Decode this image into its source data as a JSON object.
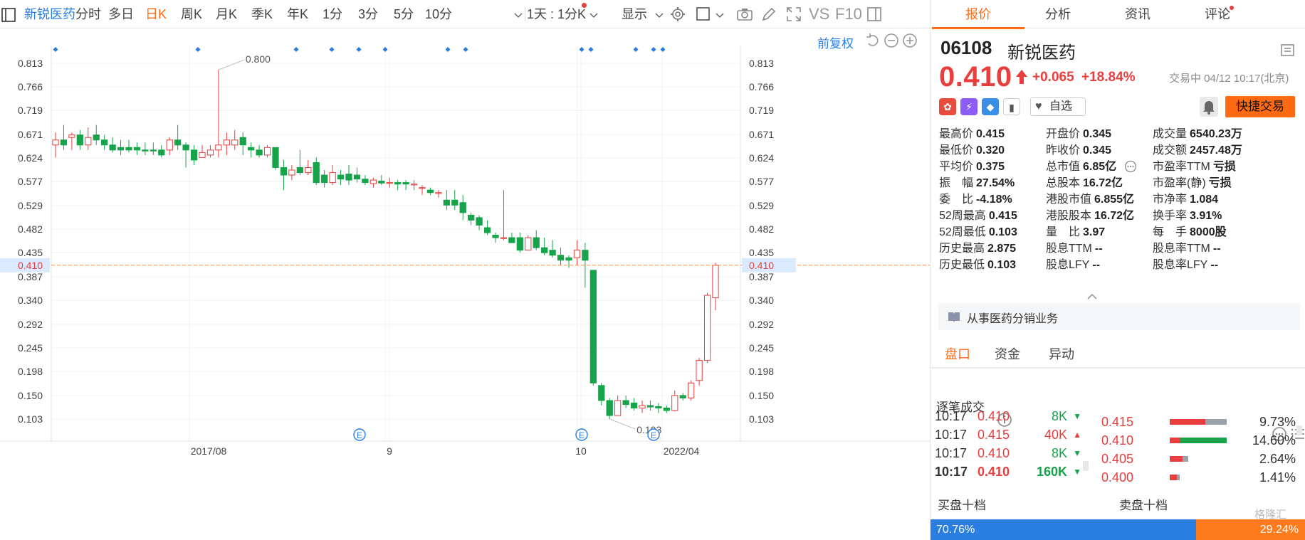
{
  "toolbar": {
    "stock_name": "新锐医药",
    "periods": [
      "分时",
      "多日",
      "日K",
      "周K",
      "月K",
      "季K",
      "年K",
      "1分",
      "3分",
      "5分",
      "10分"
    ],
    "active_period": "日K",
    "interval_select": "1天 : 1分K",
    "display_label": "显示",
    "vs_label": "VS",
    "f10_label": "F10"
  },
  "chart": {
    "fq_label": "前复权",
    "y_ticks": [
      "0.813",
      "0.766",
      "0.719",
      "0.671",
      "0.624",
      "0.577",
      "0.529",
      "0.482",
      "0.435",
      "0.387",
      "0.340",
      "0.292",
      "0.245",
      "0.198",
      "0.150",
      "0.103"
    ],
    "x_labels": [
      "2017/08",
      "9",
      "10",
      "2022/04"
    ],
    "current_price_tag": "0.410",
    "max_annotation": "0.800",
    "min_annotation": "0.103",
    "event_marker": "E"
  },
  "chart_data": {
    "type": "candlestick",
    "ylim": [
      0.103,
      0.813
    ],
    "current_price": 0.41,
    "candles": [
      {
        "o": 0.65,
        "c": 0.66,
        "h": 0.675,
        "l": 0.625
      },
      {
        "o": 0.66,
        "c": 0.65,
        "h": 0.69,
        "l": 0.64
      },
      {
        "o": 0.665,
        "c": 0.67,
        "h": 0.675,
        "l": 0.64
      },
      {
        "o": 0.67,
        "c": 0.65,
        "h": 0.68,
        "l": 0.64
      },
      {
        "o": 0.65,
        "c": 0.665,
        "h": 0.685,
        "l": 0.64
      },
      {
        "o": 0.67,
        "c": 0.66,
        "h": 0.69,
        "l": 0.65
      },
      {
        "o": 0.66,
        "c": 0.65,
        "h": 0.67,
        "l": 0.64
      },
      {
        "o": 0.65,
        "c": 0.64,
        "h": 0.665,
        "l": 0.635
      },
      {
        "o": 0.645,
        "c": 0.64,
        "h": 0.66,
        "l": 0.63
      },
      {
        "o": 0.645,
        "c": 0.64,
        "h": 0.66,
        "l": 0.635
      },
      {
        "o": 0.645,
        "c": 0.64,
        "h": 0.655,
        "l": 0.63
      },
      {
        "o": 0.64,
        "c": 0.638,
        "h": 0.655,
        "l": 0.63
      },
      {
        "o": 0.64,
        "c": 0.638,
        "h": 0.655,
        "l": 0.63
      },
      {
        "o": 0.64,
        "c": 0.63,
        "h": 0.65,
        "l": 0.625
      },
      {
        "o": 0.64,
        "c": 0.66,
        "h": 0.665,
        "l": 0.63
      },
      {
        "o": 0.66,
        "c": 0.65,
        "h": 0.69,
        "l": 0.64
      },
      {
        "o": 0.65,
        "c": 0.64,
        "h": 0.655,
        "l": 0.605
      },
      {
        "o": 0.64,
        "c": 0.62,
        "h": 0.65,
        "l": 0.61
      },
      {
        "o": 0.625,
        "c": 0.635,
        "h": 0.65,
        "l": 0.625
      },
      {
        "o": 0.63,
        "c": 0.64,
        "h": 0.65,
        "l": 0.625
      },
      {
        "o": 0.64,
        "c": 0.65,
        "h": 0.8,
        "l": 0.625
      },
      {
        "o": 0.65,
        "c": 0.66,
        "h": 0.675,
        "l": 0.63
      },
      {
        "o": 0.65,
        "c": 0.66,
        "h": 0.68,
        "l": 0.64
      },
      {
        "o": 0.665,
        "c": 0.65,
        "h": 0.675,
        "l": 0.63
      },
      {
        "o": 0.645,
        "c": 0.64,
        "h": 0.655,
        "l": 0.625
      },
      {
        "o": 0.64,
        "c": 0.63,
        "h": 0.65,
        "l": 0.625
      },
      {
        "o": 0.63,
        "c": 0.645,
        "h": 0.65,
        "l": 0.625
      },
      {
        "o": 0.645,
        "c": 0.605,
        "h": 0.645,
        "l": 0.6
      },
      {
        "o": 0.605,
        "c": 0.59,
        "h": 0.62,
        "l": 0.56
      },
      {
        "o": 0.59,
        "c": 0.6,
        "h": 0.61,
        "l": 0.58
      },
      {
        "o": 0.605,
        "c": 0.595,
        "h": 0.64,
        "l": 0.59
      },
      {
        "o": 0.595,
        "c": 0.605,
        "h": 0.62,
        "l": 0.59
      },
      {
        "o": 0.615,
        "c": 0.575,
        "h": 0.625,
        "l": 0.57
      },
      {
        "o": 0.59,
        "c": 0.575,
        "h": 0.6,
        "l": 0.565
      },
      {
        "o": 0.575,
        "c": 0.595,
        "h": 0.61,
        "l": 0.57
      },
      {
        "o": 0.59,
        "c": 0.582,
        "h": 0.6,
        "l": 0.57
      },
      {
        "o": 0.592,
        "c": 0.58,
        "h": 0.61,
        "l": 0.57
      },
      {
        "o": 0.59,
        "c": 0.582,
        "h": 0.605,
        "l": 0.575
      },
      {
        "o": 0.582,
        "c": 0.575,
        "h": 0.59,
        "l": 0.57
      },
      {
        "o": 0.573,
        "c": 0.58,
        "h": 0.585,
        "l": 0.565
      },
      {
        "o": 0.578,
        "c": 0.574,
        "h": 0.59,
        "l": 0.57
      },
      {
        "o": 0.575,
        "c": 0.575,
        "h": 0.585,
        "l": 0.565
      },
      {
        "o": 0.575,
        "c": 0.572,
        "h": 0.58,
        "l": 0.56
      },
      {
        "o": 0.575,
        "c": 0.572,
        "h": 0.58,
        "l": 0.56
      },
      {
        "o": 0.572,
        "c": 0.572,
        "h": 0.58,
        "l": 0.56
      },
      {
        "o": 0.565,
        "c": 0.565,
        "h": 0.57,
        "l": 0.55
      },
      {
        "o": 0.56,
        "c": 0.555,
        "h": 0.565,
        "l": 0.55
      },
      {
        "o": 0.555,
        "c": 0.555,
        "h": 0.56,
        "l": 0.545
      },
      {
        "o": 0.54,
        "c": 0.53,
        "h": 0.56,
        "l": 0.52
      },
      {
        "o": 0.54,
        "c": 0.53,
        "h": 0.56,
        "l": 0.52
      },
      {
        "o": 0.535,
        "c": 0.515,
        "h": 0.55,
        "l": 0.5
      },
      {
        "o": 0.51,
        "c": 0.5,
        "h": 0.515,
        "l": 0.49
      },
      {
        "o": 0.505,
        "c": 0.49,
        "h": 0.51,
        "l": 0.48
      },
      {
        "o": 0.485,
        "c": 0.475,
        "h": 0.5,
        "l": 0.47
      },
      {
        "o": 0.47,
        "c": 0.465,
        "h": 0.475,
        "l": 0.455
      },
      {
        "o": 0.465,
        "c": 0.465,
        "h": 0.56,
        "l": 0.46
      },
      {
        "o": 0.465,
        "c": 0.455,
        "h": 0.475,
        "l": 0.455
      },
      {
        "o": 0.465,
        "c": 0.44,
        "h": 0.475,
        "l": 0.435
      },
      {
        "o": 0.44,
        "c": 0.465,
        "h": 0.47,
        "l": 0.44
      },
      {
        "o": 0.465,
        "c": 0.445,
        "h": 0.48,
        "l": 0.44
      },
      {
        "o": 0.445,
        "c": 0.435,
        "h": 0.465,
        "l": 0.43
      },
      {
        "o": 0.44,
        "c": 0.43,
        "h": 0.46,
        "l": 0.425
      },
      {
        "o": 0.43,
        "c": 0.42,
        "h": 0.445,
        "l": 0.41
      },
      {
        "o": 0.425,
        "c": 0.42,
        "h": 0.43,
        "l": 0.405
      },
      {
        "o": 0.425,
        "c": 0.44,
        "h": 0.46,
        "l": 0.41
      },
      {
        "o": 0.44,
        "c": 0.42,
        "h": 0.455,
        "l": 0.365
      },
      {
        "o": 0.4,
        "c": 0.175,
        "h": 0.4,
        "l": 0.17
      },
      {
        "o": 0.17,
        "c": 0.14,
        "h": 0.175,
        "l": 0.13
      },
      {
        "o": 0.14,
        "c": 0.11,
        "h": 0.145,
        "l": 0.103
      },
      {
        "o": 0.11,
        "c": 0.14,
        "h": 0.15,
        "l": 0.11
      },
      {
        "o": 0.14,
        "c": 0.132,
        "h": 0.15,
        "l": 0.125
      },
      {
        "o": 0.135,
        "c": 0.125,
        "h": 0.145,
        "l": 0.12
      },
      {
        "o": 0.125,
        "c": 0.13,
        "h": 0.14,
        "l": 0.115
      },
      {
        "o": 0.13,
        "c": 0.127,
        "h": 0.14,
        "l": 0.12
      },
      {
        "o": 0.128,
        "c": 0.125,
        "h": 0.135,
        "l": 0.115
      },
      {
        "o": 0.125,
        "c": 0.12,
        "h": 0.13,
        "l": 0.115
      },
      {
        "o": 0.12,
        "c": 0.15,
        "h": 0.16,
        "l": 0.118
      },
      {
        "o": 0.15,
        "c": 0.145,
        "h": 0.155,
        "l": 0.14
      },
      {
        "o": 0.145,
        "c": 0.175,
        "h": 0.18,
        "l": 0.14
      },
      {
        "o": 0.18,
        "c": 0.22,
        "h": 0.225,
        "l": 0.17
      },
      {
        "o": 0.22,
        "c": 0.35,
        "h": 0.355,
        "l": 0.215
      },
      {
        "o": 0.345,
        "c": 0.41,
        "h": 0.415,
        "l": 0.32
      }
    ]
  },
  "quote": {
    "code": "06108",
    "name": "新锐医药",
    "price": "0.410",
    "change": "+0.065",
    "change_pct": "+18.84%",
    "status": "交易中 04/12 10:17(北京)",
    "badges": [
      "港",
      "沪",
      "标",
      "资"
    ],
    "watch_label": "自选",
    "quick_trade_label": "快捷交易",
    "business": "从事医药分销业务"
  },
  "stats": [
    [
      {
        "label": "最高价",
        "value": "0.415",
        "tone": "red"
      },
      {
        "label": "开盘价",
        "value": "0.345",
        "tone": ""
      },
      {
        "label": "成交量",
        "value": "6540.23万",
        "tone": ""
      }
    ],
    [
      {
        "label": "最低价",
        "value": "0.320",
        "tone": "green"
      },
      {
        "label": "昨收价",
        "value": "0.345",
        "tone": ""
      },
      {
        "label": "成交额",
        "value": "2457.48万",
        "tone": ""
      }
    ],
    [
      {
        "label": "平均价",
        "value": "0.375",
        "tone": "red"
      },
      {
        "label": "总市值",
        "value": "6.85亿",
        "tone": ""
      },
      {
        "label": "市盈率TTM",
        "value": "亏损",
        "tone": ""
      }
    ],
    [
      {
        "label": "振　幅",
        "value": "27.54%",
        "tone": ""
      },
      {
        "label": "总股本",
        "value": "16.72亿",
        "tone": ""
      },
      {
        "label": "市盈率(静)",
        "value": "亏损",
        "tone": ""
      }
    ],
    [
      {
        "label": "委　比",
        "value": "-4.18%",
        "tone": ""
      },
      {
        "label": "港股市值",
        "value": "6.855亿",
        "tone": ""
      },
      {
        "label": "市净率",
        "value": "1.084",
        "tone": ""
      }
    ],
    [
      {
        "label": "52周最高",
        "value": "0.415",
        "tone": "red"
      },
      {
        "label": "港股股本",
        "value": "16.72亿",
        "tone": ""
      },
      {
        "label": "换手率",
        "value": "3.91%",
        "tone": ""
      }
    ],
    [
      {
        "label": "52周最低",
        "value": "0.103",
        "tone": "green"
      },
      {
        "label": "量　比",
        "value": "3.97",
        "tone": ""
      },
      {
        "label": "每　手",
        "value": "8000股",
        "tone": ""
      }
    ],
    [
      {
        "label": "历史最高",
        "value": "2.875",
        "tone": "red"
      },
      {
        "label": "股息TTM",
        "value": "--",
        "tone": ""
      },
      {
        "label": "股息率TTM",
        "value": "--",
        "tone": ""
      }
    ],
    [
      {
        "label": "历史最低",
        "value": "0.103",
        "tone": "green"
      },
      {
        "label": "股息LFY",
        "value": "--",
        "tone": ""
      },
      {
        "label": "股息率LFY",
        "value": "--",
        "tone": ""
      }
    ]
  ],
  "panel_tabs": [
    "报价",
    "分析",
    "资讯",
    "评论"
  ],
  "bottom_tabs": [
    "盘口",
    "资金",
    "异动"
  ],
  "ticks_title": "逐笔成交",
  "ticks": [
    {
      "time": "10:17",
      "price": "0.410",
      "vol": "8K",
      "dir": "down"
    },
    {
      "time": "10:17",
      "price": "0.415",
      "vol": "40K",
      "dir": "up"
    },
    {
      "time": "10:17",
      "price": "0.410",
      "vol": "8K",
      "dir": "down"
    },
    {
      "time": "10:17",
      "price": "0.410",
      "vol": "160K",
      "dir": "down"
    }
  ],
  "orderbook": [
    {
      "price": "0.415",
      "pct": "9.73%",
      "red": 0.62,
      "gray": 0.38
    },
    {
      "price": "0.410",
      "pct": "14.60%",
      "red": 0.18,
      "green": 0.82
    },
    {
      "price": "0.405",
      "pct": "2.64%",
      "red": 0.22,
      "gray": 0.1
    },
    {
      "price": "0.400",
      "pct": "1.41%",
      "red": 0.12,
      "gray": 0.05
    }
  ],
  "book_labels": {
    "buy": "买盘十档",
    "sell": "卖盘十档"
  },
  "ratio": {
    "buy": "70.76%",
    "sell": "29.24%",
    "buy_fraction": 0.7076
  },
  "watermark": "格隆汇",
  "colors": {
    "up": "#e83e3e",
    "down": "#16a34a",
    "accent": "#ff6a13",
    "link": "#2a7de1"
  }
}
